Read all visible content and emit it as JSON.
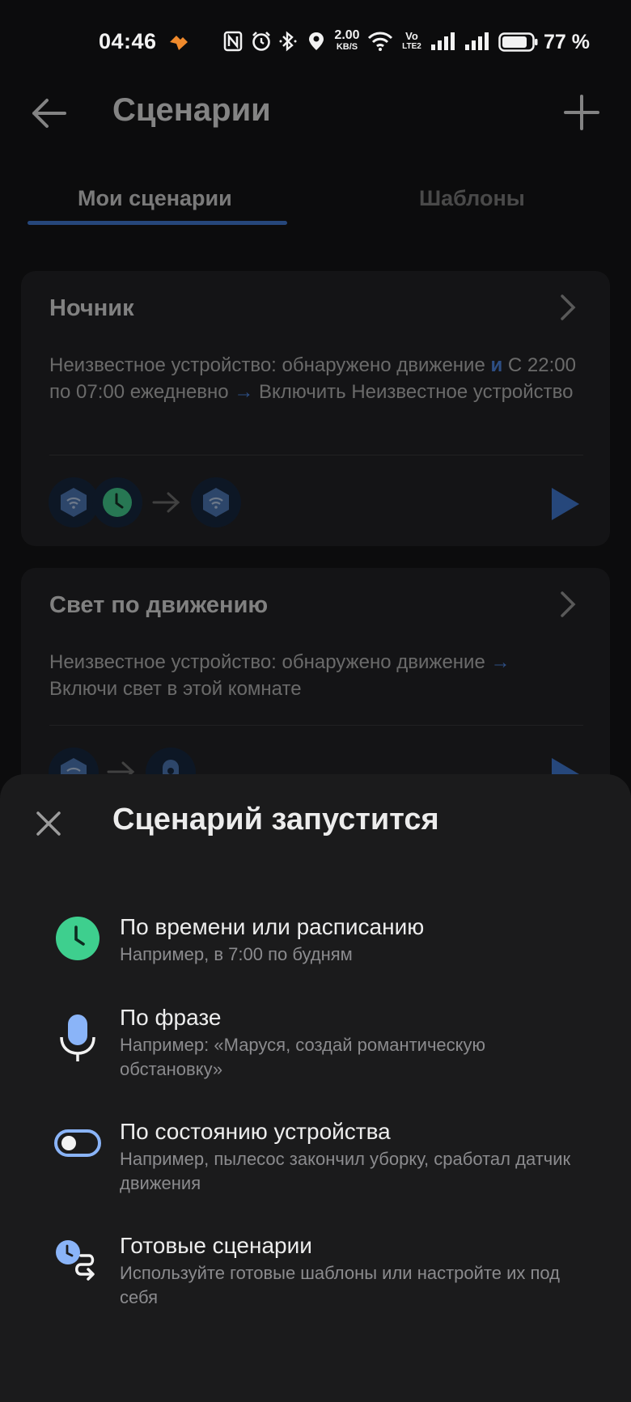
{
  "status_bar": {
    "time": "04:46",
    "network_speed_value": "2.00",
    "network_speed_unit": "KB/S",
    "volte_top": "Vo",
    "volte_bottom": "LTE2",
    "battery_percent": "77 %"
  },
  "header": {
    "title": "Сценарии"
  },
  "tabs": [
    {
      "label": "Мои сценарии",
      "active": true
    },
    {
      "label": "Шаблоны",
      "active": false
    }
  ],
  "scenarios": [
    {
      "title": "Ночник",
      "desc_part1": "Неизвестное устройство: обнаружено движение ",
      "desc_and": "и",
      "desc_part2": " С 22:00 по 07:00 ежедневно ",
      "desc_arrow": "→",
      "desc_part3": " Включить Неизвестное устройство"
    },
    {
      "title": "Свет по движению",
      "desc_part1": "Неизвестное устройство: обнаружено движение ",
      "desc_arrow": "→",
      "desc_part2": " Включи свет в этой комнате"
    }
  ],
  "sheet": {
    "title": "Сценарий запустится",
    "options": [
      {
        "title": "По времени или расписанию",
        "subtitle": "Например, в 7:00 по будням",
        "icon": "clock-icon"
      },
      {
        "title": "По фразе",
        "subtitle": "Например: «Маруся, создай романтическую обстановку»",
        "icon": "microphone-icon"
      },
      {
        "title": "По состоянию устройства",
        "subtitle": "Например, пылесос закончил уборку, сработал датчик движения",
        "icon": "toggle-icon"
      },
      {
        "title": "Готовые сценарии",
        "subtitle": "Используйте готовые шаблоны или настройте их под себя",
        "icon": "ready-scenario-icon"
      }
    ]
  },
  "colors": {
    "accent": "#3d78d8",
    "clock_green": "#3ecf8e",
    "icon_blue": "#8ab4f8",
    "background": "#0c0c0d",
    "sheet": "#1b1b1c"
  }
}
